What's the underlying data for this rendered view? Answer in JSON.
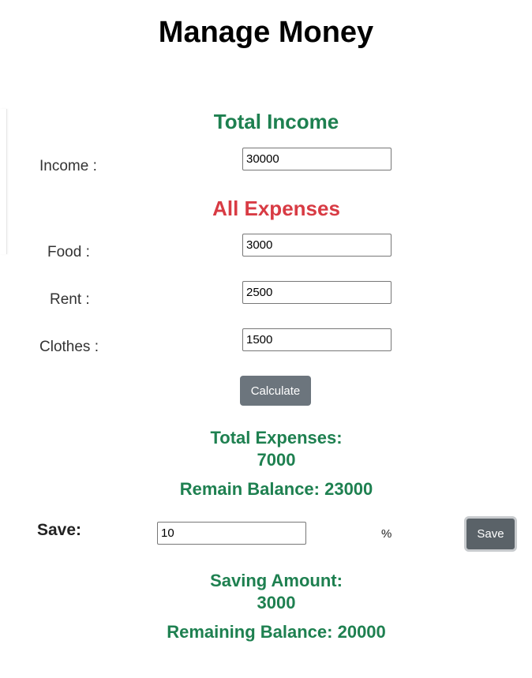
{
  "page": {
    "title": "Manage Money"
  },
  "income_section": {
    "heading": "Total Income",
    "income_label": "Income :",
    "income_value": "30000"
  },
  "expenses_section": {
    "heading": "All Expenses",
    "food_label": "Food :",
    "food_value": "3000",
    "rent_label": "Rent :",
    "rent_value": "2500",
    "clothes_label": "Clothes :",
    "clothes_value": "1500",
    "calculate_label": "Calculate"
  },
  "results": {
    "total_expenses_label": "Total Expenses:",
    "total_expenses_value": "7000",
    "remain_balance_text": "Remain Balance: 23000"
  },
  "saving_section": {
    "save_label": "Save:",
    "percent_value": "10",
    "percent_sign": "%",
    "save_button_label": "Save",
    "saving_amount_label": "Saving Amount:",
    "saving_amount_value": "3000",
    "remaining_balance_text": "Remaining Balance: 20000"
  },
  "colors": {
    "green": "#1e8050",
    "red": "#d83b44",
    "button_gray": "#6c757d"
  }
}
